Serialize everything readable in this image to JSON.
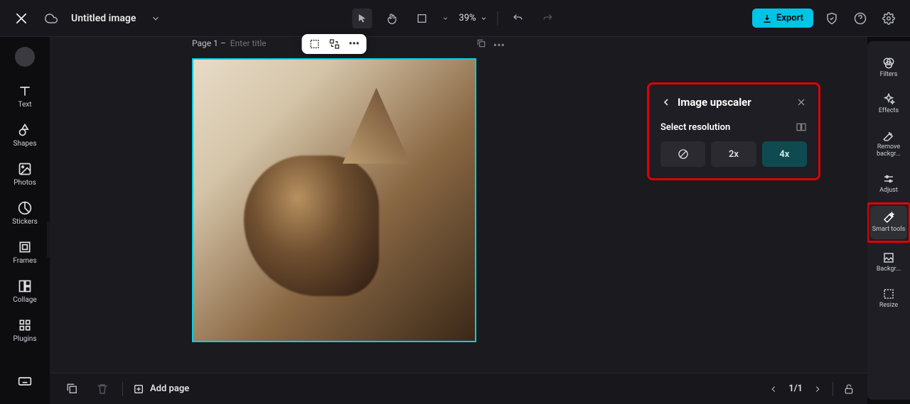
{
  "topbar": {
    "doc_title": "Untitled image",
    "zoom": "39%",
    "export_label": "Export"
  },
  "left_sidebar": {
    "items": [
      {
        "label": "Text"
      },
      {
        "label": "Shapes"
      },
      {
        "label": "Photos"
      },
      {
        "label": "Stickers"
      },
      {
        "label": "Frames"
      },
      {
        "label": "Collage"
      },
      {
        "label": "Plugins"
      }
    ]
  },
  "canvas": {
    "page_label": "Page 1 –",
    "title_placeholder": "Enter title"
  },
  "right_sidebar": {
    "items": [
      {
        "label": "Filters"
      },
      {
        "label": "Effects"
      },
      {
        "label": "Remove backgr..."
      },
      {
        "label": "Adjust"
      },
      {
        "label": "Smart tools"
      },
      {
        "label": "Backgr..."
      },
      {
        "label": "Resize"
      }
    ]
  },
  "panel": {
    "title": "Image upscaler",
    "section_label": "Select resolution",
    "options": {
      "none": "",
      "x2": "2x",
      "x4": "4x"
    }
  },
  "bottombar": {
    "add_page": "Add page",
    "page_counter": "1/1"
  }
}
